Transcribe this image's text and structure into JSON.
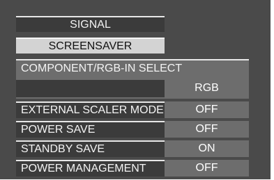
{
  "menu": {
    "tabs": [
      {
        "label": "SIGNAL",
        "active": false
      },
      {
        "label": "SCREENSAVER",
        "active": true
      }
    ],
    "component_select": {
      "label": "COMPONENT/RGB-IN SELECT",
      "value": "RGB"
    },
    "rows": [
      {
        "label": "EXTERNAL SCALER MODE",
        "value": "OFF"
      },
      {
        "label": "POWER SAVE",
        "value": "OFF"
      },
      {
        "label": "STANDBY SAVE",
        "value": "ON"
      },
      {
        "label": "POWER MANAGEMENT",
        "value": "OFF"
      }
    ]
  },
  "colors": {
    "panel_bg": "#4a4a4a",
    "label_bg": "#3b3b3b",
    "value_bg": "#6d6d6d",
    "highlight_bg": "#d3d3d3",
    "text": "#ffffff"
  }
}
